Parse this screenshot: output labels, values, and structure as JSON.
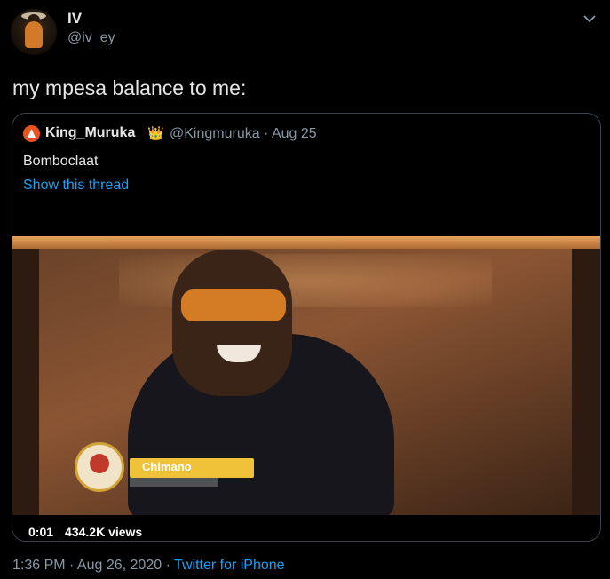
{
  "tweet": {
    "author_name": "IV",
    "author_handle": "@iv_ey",
    "text": "my mpesa balance to me:",
    "timestamp": "1:36 PM · Aug 26, 2020",
    "separator": " · ",
    "source": "Twitter for iPhone"
  },
  "quoted": {
    "author_name": "King_Muruka",
    "badge_emoji": "👑",
    "handle_and_date": "@Kingmuruka · Aug 25",
    "text": "Bomboclaat",
    "thread_link": "Show this thread",
    "video": {
      "elapsed": "0:01",
      "views": "434.2K views",
      "lower_third_label": "Chimano"
    }
  },
  "icons": {
    "more_menu": "chevron-down-icon",
    "quoted_avatar": "avatar-icon"
  },
  "colors": {
    "background": "#000000",
    "link": "#1da1f2",
    "muted": "#8899a6",
    "border": "#38444d",
    "text": "#e6e6e6"
  }
}
